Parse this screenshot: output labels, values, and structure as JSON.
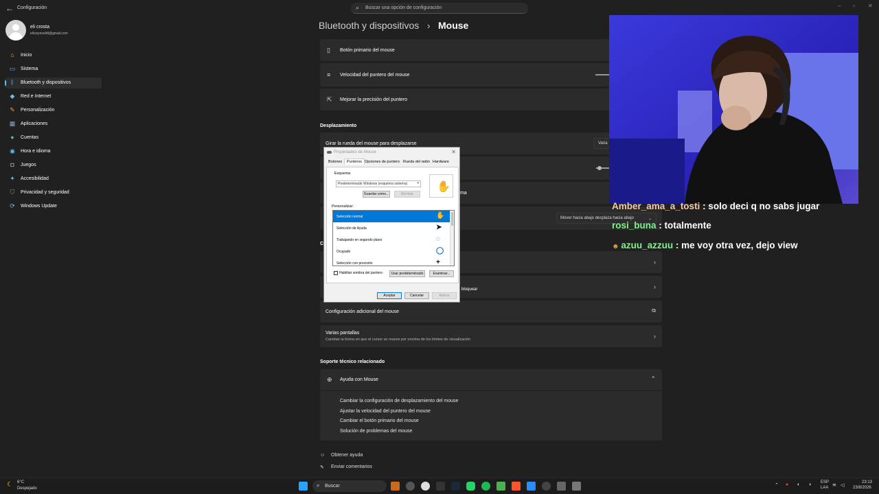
{
  "window": {
    "title": "Configuración",
    "search_placeholder": "Buscar una opción de configuración"
  },
  "user": {
    "name": "eli crosta",
    "email": "elicwynveldt@gmail.com"
  },
  "nav": [
    {
      "label": "Inicio",
      "icon": "home-icon",
      "color": "#e8a86a"
    },
    {
      "label": "Sistema",
      "icon": "monitor-icon",
      "color": "#4cc2ff"
    },
    {
      "label": "Bluetooth y dispositivos",
      "icon": "bluetooth-icon",
      "color": "#4cc2ff",
      "selected": true
    },
    {
      "label": "Red e Internet",
      "icon": "wifi-icon",
      "color": "#6fb8f0"
    },
    {
      "label": "Personalización",
      "icon": "brush-icon",
      "color": "#e89a5a"
    },
    {
      "label": "Aplicaciones",
      "icon": "apps-icon",
      "color": "#8aa7c8"
    },
    {
      "label": "Cuentas",
      "icon": "person-icon",
      "color": "#4fc27f"
    },
    {
      "label": "Hora e idioma",
      "icon": "globe-clock-icon",
      "color": "#4cc2ff"
    },
    {
      "label": "Juegos",
      "icon": "gamepad-icon",
      "color": "#aaaaaa"
    },
    {
      "label": "Accesibilidad",
      "icon": "accessibility-icon",
      "color": "#4cc2ff"
    },
    {
      "label": "Privacidad y seguridad",
      "icon": "shield-icon",
      "color": "#8a9aa8"
    },
    {
      "label": "Windows Update",
      "icon": "update-icon",
      "color": "#4cc2ff"
    }
  ],
  "breadcrumb": {
    "parent": "Bluetooth y dispositivos",
    "separator": "›",
    "current": "Mouse"
  },
  "settings": {
    "primary_button": "Botón primario del mouse",
    "pointer_speed": "Velocidad del puntero del mouse",
    "precision": "Mejorar la precisión del puntero",
    "scroll_section": "Desplazamiento",
    "wheel_scroll": "Girar la rueda del mouse para desplazarse",
    "wheel_value": "Varia",
    "scroll_dir_partial": "ma",
    "scroll_dir_value": "Mover hacia abajo desplaza hacia abajo",
    "related_partial": "C",
    "lock_partial": "bloquear",
    "additional": "Configuración adicional del mouse",
    "multi_screen": "Varias pantallas",
    "multi_screen_desc": "Cambiar la forma en que el cursor se mueve por encima de los límites de visualización",
    "support_section": "Soporte técnico relacionado",
    "help": "Ayuda con Mouse",
    "help_links": [
      "Cambiar la configuración de desplazamiento del mouse",
      "Ajustar la velocidad del puntero del mouse",
      "Cambiar el botón primario del mouse",
      "Solución de problemas del mouse"
    ],
    "get_help": "Obtener ayuda",
    "feedback": "Enviar comentarios"
  },
  "dialog": {
    "title": "Propiedades de Mouse",
    "tabs": [
      "Botones",
      "Punteros",
      "Opciones de puntero",
      "Rueda del ratón",
      "Hardware"
    ],
    "scheme_label": "Esquema",
    "scheme_value": "Predeterminado Windows (esquema sistema)",
    "save_as": "Guardar como...",
    "delete": "Eliminar",
    "customize_label": "Personalizar:",
    "cursors": [
      {
        "label": "Selección normal"
      },
      {
        "label": "Selección de Ayuda"
      },
      {
        "label": "Trabajando en segundo plano"
      },
      {
        "label": "Ocupado"
      },
      {
        "label": "Selección con precisión"
      }
    ],
    "shadow": "Habilitar sombra del puntero",
    "use_default": "Usar predeterminado",
    "browse": "Examinar...",
    "ok": "Aceptar",
    "cancel": "Cancelar",
    "apply": "Aplicar"
  },
  "chat": [
    {
      "user": "Amber_ama_a_tosti",
      "msg": " : solo deci q no sabs jugar",
      "color": "#f2cda6"
    },
    {
      "user": "rosi_buna",
      "msg": " : totalmente",
      "color": "#7df58a"
    },
    {
      "user": "azuu_azzuu",
      "msg": " : me voy otra vez, dejo view",
      "color": "#7df58a"
    }
  ],
  "taskbar": {
    "weather_temp": "6°C",
    "weather_desc": "Despejado",
    "search": "Buscar",
    "lang1": "ESP",
    "lang2": "LAA",
    "time": "23:13",
    "date": "23/8/2026"
  }
}
